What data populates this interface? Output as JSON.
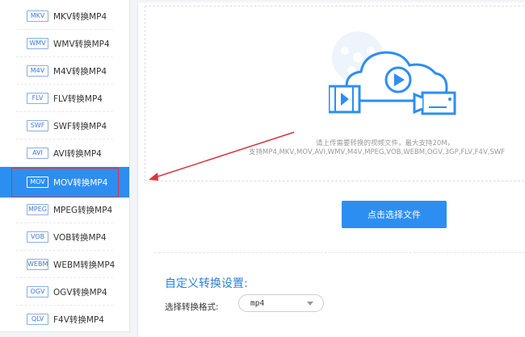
{
  "sidebar": {
    "items": [
      {
        "badge": "MKV",
        "label": "MKV转换MP4"
      },
      {
        "badge": "WMV",
        "label": "WMV转换MP4"
      },
      {
        "badge": "M4V",
        "label": "M4V转换MP4"
      },
      {
        "badge": "FLV",
        "label": "FLV转换MP4"
      },
      {
        "badge": "SWF",
        "label": "SWF转换MP4"
      },
      {
        "badge": "AVI",
        "label": "AVI转换MP4"
      },
      {
        "badge": "MOV",
        "label": "MOV转换MP4"
      },
      {
        "badge": "MPEG",
        "label": "MPEG转换MP4"
      },
      {
        "badge": "VOB",
        "label": "VOB转换MP4"
      },
      {
        "badge": "WEBM",
        "label": "WEBM转换MP4"
      },
      {
        "badge": "OGV",
        "label": "OGV转换MP4"
      },
      {
        "badge": "QLV",
        "label": "F4V转换MP4"
      }
    ],
    "active_index": 6
  },
  "upload": {
    "hint_line1": "请上传需要转换的视频文件，最大支持20M，",
    "hint_line2": "支持MP4,MKV,MOV,AVI,WMV,M4V,MPEG,VOB,WEBM,OGV,3GP,FLV,F4V,SWF",
    "button_label": "点击选择文件"
  },
  "settings": {
    "title": "自定义转换设置:",
    "format_label": "选择转换格式:",
    "format_value": "mp4"
  },
  "colors": {
    "accent": "#2d8ef2",
    "annotation_red": "#d9363a"
  }
}
